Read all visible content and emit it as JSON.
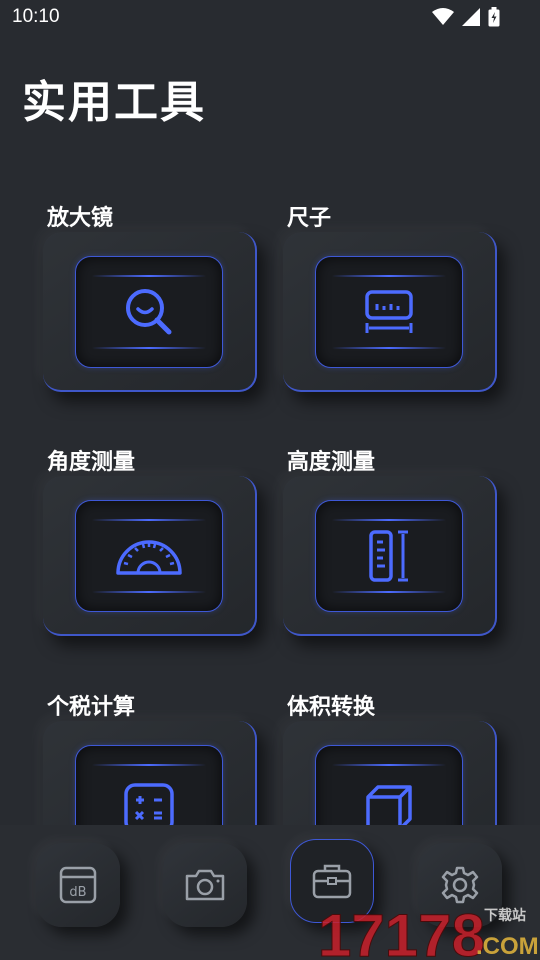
{
  "status_bar": {
    "time": "10:10"
  },
  "page_title": "实用工具",
  "tools": [
    {
      "label": "放大镜",
      "icon": "magnifier-icon"
    },
    {
      "label": "尺子",
      "icon": "ruler-icon"
    },
    {
      "label": "角度测量",
      "icon": "protractor-icon"
    },
    {
      "label": "高度测量",
      "icon": "height-ruler-icon"
    },
    {
      "label": "个税计算",
      "icon": "calculator-icon"
    },
    {
      "label": "体积转换",
      "icon": "cube-icon"
    }
  ],
  "bottom_nav": [
    {
      "icon": "decibel-icon",
      "label": "dB",
      "active": false
    },
    {
      "icon": "camera-icon",
      "active": false
    },
    {
      "icon": "toolbox-icon",
      "active": true
    },
    {
      "icon": "settings-gear-icon",
      "active": false
    }
  ],
  "watermark": {
    "number": "17178",
    "suffix": ".COM",
    "tagline": "下载站"
  },
  "colors": {
    "background": "#282b30",
    "accent": "#4c6bff",
    "text": "#ffffff",
    "watermark_red": "#d01a1a",
    "watermark_gold": "#c9a23a"
  }
}
